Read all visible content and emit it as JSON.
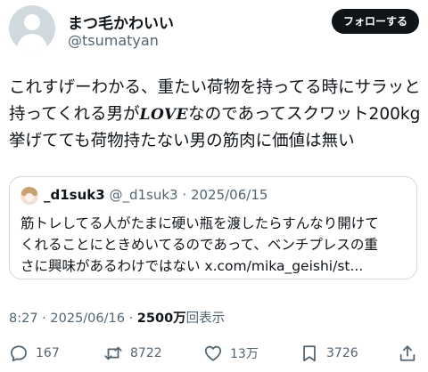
{
  "author": {
    "name": "まつ毛かわいい",
    "handle": "@tsumatyan",
    "follow_label": "フォローする"
  },
  "tweet": {
    "line1": "これすげーわかる、重たい荷物を持ってる時にサラッと",
    "line2_before": "持ってくれる男が",
    "line2_love": "LOVE",
    "line2_after": "なのであってスクワット200kg",
    "line3": "挙げてても荷物持たない男の筋肉に価値は無い"
  },
  "quote": {
    "name": "_d1suk3",
    "handle": "@_d1suk3",
    "separator": "·",
    "date": "2025/06/15",
    "line1": "筋トレしてる人がたまに硬い瓶を渡したらすんなり開けて",
    "line2": "くれることにときめいてるのであって、ベンチプレスの重",
    "line3": "さに興味があるわけではない x.com/mika_geishi/st..."
  },
  "meta": {
    "time": "8:27",
    "separator": "·",
    "date": "2025/06/16",
    "views_count": "2500万",
    "views_label": "回表示"
  },
  "actions": {
    "replies": "167",
    "retweets": "8722",
    "likes": "13万",
    "bookmarks": "3726"
  }
}
